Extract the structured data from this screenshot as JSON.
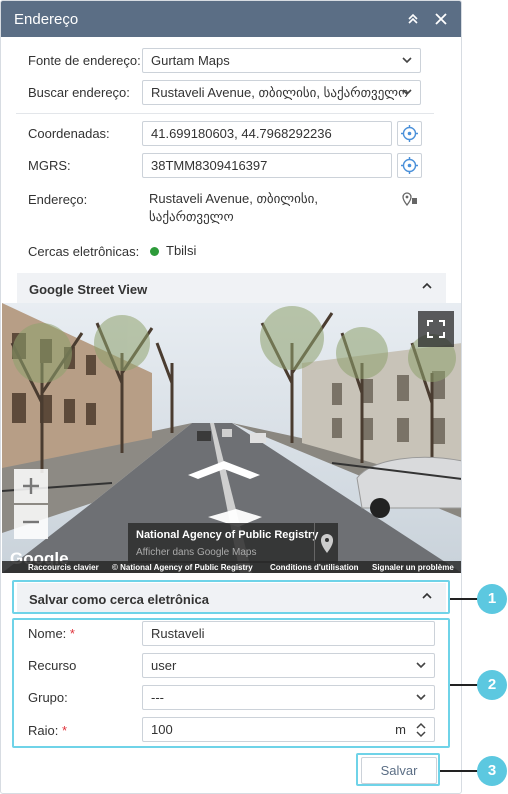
{
  "window": {
    "title": "Endereço"
  },
  "address": {
    "source_label": "Fonte de endereço:",
    "source_value": "Gurtam Maps",
    "search_label": "Buscar endereço:",
    "search_value": "Rustaveli Avenue, თბილისი, საქართველო",
    "coords_label": "Coordenadas:",
    "coords_value": "41.699180603, 44.7968292236",
    "mgrs_label": "MGRS:",
    "mgrs_value": "38TMM8309416397",
    "address_label": "Endereço:",
    "address_line1": "Rustaveli Avenue, თბილისი,",
    "address_line2": "საქართველო",
    "geofences_label": "Cercas eletrônicas:",
    "geofence_value": "Tbilsi"
  },
  "street_view": {
    "title": "Google Street View",
    "info_title": "National Agency of Public Registry",
    "info_sub": "Afficher dans Google Maps",
    "google_logo": "Google",
    "footer": [
      "Raccourcis clavier",
      "© National Agency of Public Registry",
      "Conditions d'utilisation",
      "Signaler un problème"
    ]
  },
  "geofence_form": {
    "title": "Salvar como cerca eletrônica",
    "name_label": "Nome:",
    "name_value": "Rustaveli",
    "resource_label": "Recurso",
    "resource_value": "user",
    "group_label": "Grupo:",
    "group_value": "---",
    "radius_label": "Raio:",
    "radius_value": "100",
    "radius_unit": "m",
    "required_mark": "*",
    "save_label": "Salvar"
  },
  "callouts": [
    "1",
    "2",
    "3"
  ],
  "colors": {
    "titlebar": "#5b6e85",
    "highlight": "#6fd3e8",
    "callout": "#5cc8e0",
    "status_green": "#2d9b3a",
    "required": "#e0323a"
  }
}
